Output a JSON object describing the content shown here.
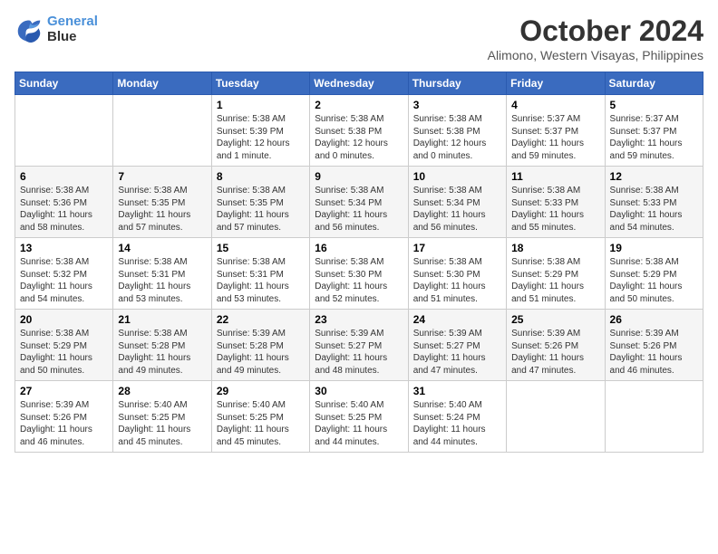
{
  "header": {
    "logo_line1": "General",
    "logo_line2": "Blue",
    "month_year": "October 2024",
    "location": "Alimono, Western Visayas, Philippines"
  },
  "columns": [
    "Sunday",
    "Monday",
    "Tuesday",
    "Wednesday",
    "Thursday",
    "Friday",
    "Saturday"
  ],
  "weeks": [
    [
      {
        "day": "",
        "content": ""
      },
      {
        "day": "",
        "content": ""
      },
      {
        "day": "1",
        "content": "Sunrise: 5:38 AM\nSunset: 5:39 PM\nDaylight: 12 hours\nand 1 minute."
      },
      {
        "day": "2",
        "content": "Sunrise: 5:38 AM\nSunset: 5:38 PM\nDaylight: 12 hours\nand 0 minutes."
      },
      {
        "day": "3",
        "content": "Sunrise: 5:38 AM\nSunset: 5:38 PM\nDaylight: 12 hours\nand 0 minutes."
      },
      {
        "day": "4",
        "content": "Sunrise: 5:37 AM\nSunset: 5:37 PM\nDaylight: 11 hours\nand 59 minutes."
      },
      {
        "day": "5",
        "content": "Sunrise: 5:37 AM\nSunset: 5:37 PM\nDaylight: 11 hours\nand 59 minutes."
      }
    ],
    [
      {
        "day": "6",
        "content": "Sunrise: 5:38 AM\nSunset: 5:36 PM\nDaylight: 11 hours\nand 58 minutes."
      },
      {
        "day": "7",
        "content": "Sunrise: 5:38 AM\nSunset: 5:35 PM\nDaylight: 11 hours\nand 57 minutes."
      },
      {
        "day": "8",
        "content": "Sunrise: 5:38 AM\nSunset: 5:35 PM\nDaylight: 11 hours\nand 57 minutes."
      },
      {
        "day": "9",
        "content": "Sunrise: 5:38 AM\nSunset: 5:34 PM\nDaylight: 11 hours\nand 56 minutes."
      },
      {
        "day": "10",
        "content": "Sunrise: 5:38 AM\nSunset: 5:34 PM\nDaylight: 11 hours\nand 56 minutes."
      },
      {
        "day": "11",
        "content": "Sunrise: 5:38 AM\nSunset: 5:33 PM\nDaylight: 11 hours\nand 55 minutes."
      },
      {
        "day": "12",
        "content": "Sunrise: 5:38 AM\nSunset: 5:33 PM\nDaylight: 11 hours\nand 54 minutes."
      }
    ],
    [
      {
        "day": "13",
        "content": "Sunrise: 5:38 AM\nSunset: 5:32 PM\nDaylight: 11 hours\nand 54 minutes."
      },
      {
        "day": "14",
        "content": "Sunrise: 5:38 AM\nSunset: 5:31 PM\nDaylight: 11 hours\nand 53 minutes."
      },
      {
        "day": "15",
        "content": "Sunrise: 5:38 AM\nSunset: 5:31 PM\nDaylight: 11 hours\nand 53 minutes."
      },
      {
        "day": "16",
        "content": "Sunrise: 5:38 AM\nSunset: 5:30 PM\nDaylight: 11 hours\nand 52 minutes."
      },
      {
        "day": "17",
        "content": "Sunrise: 5:38 AM\nSunset: 5:30 PM\nDaylight: 11 hours\nand 51 minutes."
      },
      {
        "day": "18",
        "content": "Sunrise: 5:38 AM\nSunset: 5:29 PM\nDaylight: 11 hours\nand 51 minutes."
      },
      {
        "day": "19",
        "content": "Sunrise: 5:38 AM\nSunset: 5:29 PM\nDaylight: 11 hours\nand 50 minutes."
      }
    ],
    [
      {
        "day": "20",
        "content": "Sunrise: 5:38 AM\nSunset: 5:29 PM\nDaylight: 11 hours\nand 50 minutes."
      },
      {
        "day": "21",
        "content": "Sunrise: 5:38 AM\nSunset: 5:28 PM\nDaylight: 11 hours\nand 49 minutes."
      },
      {
        "day": "22",
        "content": "Sunrise: 5:39 AM\nSunset: 5:28 PM\nDaylight: 11 hours\nand 49 minutes."
      },
      {
        "day": "23",
        "content": "Sunrise: 5:39 AM\nSunset: 5:27 PM\nDaylight: 11 hours\nand 48 minutes."
      },
      {
        "day": "24",
        "content": "Sunrise: 5:39 AM\nSunset: 5:27 PM\nDaylight: 11 hours\nand 47 minutes."
      },
      {
        "day": "25",
        "content": "Sunrise: 5:39 AM\nSunset: 5:26 PM\nDaylight: 11 hours\nand 47 minutes."
      },
      {
        "day": "26",
        "content": "Sunrise: 5:39 AM\nSunset: 5:26 PM\nDaylight: 11 hours\nand 46 minutes."
      }
    ],
    [
      {
        "day": "27",
        "content": "Sunrise: 5:39 AM\nSunset: 5:26 PM\nDaylight: 11 hours\nand 46 minutes."
      },
      {
        "day": "28",
        "content": "Sunrise: 5:40 AM\nSunset: 5:25 PM\nDaylight: 11 hours\nand 45 minutes."
      },
      {
        "day": "29",
        "content": "Sunrise: 5:40 AM\nSunset: 5:25 PM\nDaylight: 11 hours\nand 45 minutes."
      },
      {
        "day": "30",
        "content": "Sunrise: 5:40 AM\nSunset: 5:25 PM\nDaylight: 11 hours\nand 44 minutes."
      },
      {
        "day": "31",
        "content": "Sunrise: 5:40 AM\nSunset: 5:24 PM\nDaylight: 11 hours\nand 44 minutes."
      },
      {
        "day": "",
        "content": ""
      },
      {
        "day": "",
        "content": ""
      }
    ]
  ]
}
